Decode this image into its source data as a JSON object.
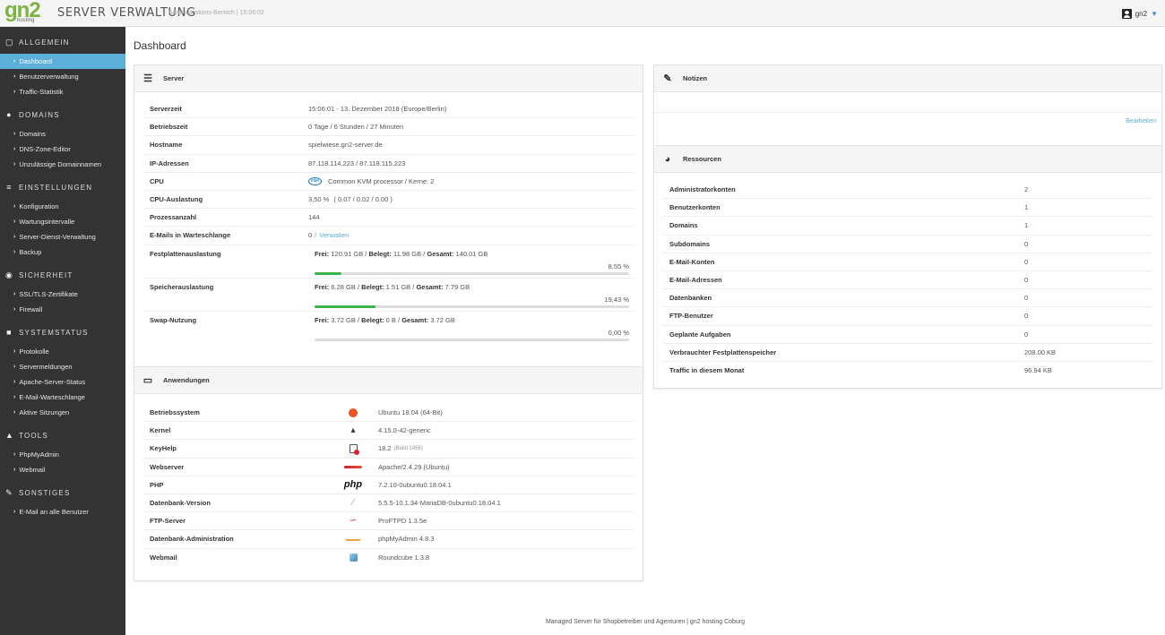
{
  "header": {
    "logo_text": "gn2",
    "logo_sub": "hosting",
    "title": "SERVER VERWALTUNG",
    "subtitle": "Administrations-Bereich | 15:06:02",
    "user": "gn2"
  },
  "sidebar": {
    "sections": [
      {
        "label": "ALLGEMEIN",
        "icon": "monitor-icon",
        "items": [
          "Dashboard",
          "Benutzerverwaltung",
          "Traffic-Statistik"
        ]
      },
      {
        "label": "DOMAINS",
        "icon": "globe-icon",
        "items": [
          "Domains",
          "DNS-Zone-Editor",
          "Unzulässige Domainnamen"
        ]
      },
      {
        "label": "EINSTELLUNGEN",
        "icon": "sliders-icon",
        "items": [
          "Konfiguration",
          "Wartungsintervalle",
          "Server-Dienst-Verwaltung",
          "Backup"
        ]
      },
      {
        "label": "SICHERHEIT",
        "icon": "shield-icon",
        "items": [
          "SSL/TLS-Zertifikate",
          "Firewall"
        ]
      },
      {
        "label": "SYSTEMSTATUS",
        "icon": "document-icon",
        "items": [
          "Protokolle",
          "Servermeldungen",
          "Apache-Server-Status",
          "E-Mail-Warteschlange",
          "Aktive Sitzungen"
        ]
      },
      {
        "label": "TOOLS",
        "icon": "car-icon",
        "items": [
          "PhpMyAdmin",
          "Webmail"
        ]
      },
      {
        "label": "SONSTIGES",
        "icon": "pen-icon",
        "items": [
          "E-Mail an alle Benutzer"
        ]
      }
    ],
    "active_item": "Dashboard"
  },
  "page_title": "Dashboard",
  "server": {
    "title": "Server",
    "rows": [
      {
        "key": "Serverzeit",
        "value": "15:06:01 - 13. Dezember 2018 (Europe/Berlin)"
      },
      {
        "key": "Betriebszeit",
        "value": "0 Tage / 6 Stunden / 27 Minuten"
      },
      {
        "key": "Hostname",
        "value": "spielwiese.gn2-server.de"
      },
      {
        "key": "IP-Adressen",
        "value": "87.118.114.223 / 87.118.115.223"
      },
      {
        "key": "CPU",
        "value": "Common KVM processor / Kerne: 2",
        "logo": "intel"
      },
      {
        "key": "CPU-Auslastung",
        "value_green": "3,50 %",
        "value": "( 0.07 / 0.02 / 0.00 )"
      },
      {
        "key": "Prozessanzahl",
        "value": "144"
      },
      {
        "key": "E-Mails in Warteschlange",
        "value": "0",
        "sep": "/",
        "link": "Verwalten"
      }
    ],
    "disks": [
      {
        "key": "Festplattenauslastung",
        "free_label": "Frei:",
        "free": "120.91 GB",
        "used_label": "Belegt:",
        "used": "11.98 GB",
        "total_label": "Gesamt:",
        "total": "140.01 GB",
        "pct": "8,55 %",
        "fraction": 0.0855
      },
      {
        "key": "Speicherauslastung",
        "free_label": "Frei:",
        "free": "6.28 GB",
        "used_label": "Belegt:",
        "used": "1.51 GB",
        "total_label": "Gesamt:",
        "total": "7.79 GB",
        "pct": "19,43 %",
        "fraction": 0.1943
      },
      {
        "key": "Swap-Nutzung",
        "free_label": "Frei:",
        "free": "3.72 GB",
        "used_label": "Belegt:",
        "used": "0 B",
        "total_label": "Gesamt:",
        "total": "3.72 GB",
        "pct": "0,00 %",
        "fraction": 0
      }
    ]
  },
  "apps": {
    "title": "Anwendungen",
    "rows": [
      {
        "key": "Betriebssystem",
        "value": "Ubuntu 18.04 (64-Bit)",
        "icon": "ubuntu-icon"
      },
      {
        "key": "Kernel",
        "value": "4.15.0-42-generic",
        "icon": "tux-icon"
      },
      {
        "key": "KeyHelp",
        "value": "18.2",
        "build": "(Build 1456)",
        "icon": "keyhelp-icon"
      },
      {
        "key": "Webserver",
        "value": "Apache/2.4.29 (Ubuntu)",
        "icon": "apache-icon"
      },
      {
        "key": "PHP",
        "value": "7.2.10-0ubuntu0.18.04.1",
        "icon": "php-icon",
        "icon_text": "php"
      },
      {
        "key": "Datenbank-Version",
        "value": "5.5.5-10.1.34-MariaDB-0ubuntu0.18.04.1",
        "icon": "mariadb-icon"
      },
      {
        "key": "FTP-Server",
        "value": "ProFTPD 1.3.5e",
        "icon": "proftpd-icon"
      },
      {
        "key": "Datenbank-Administration",
        "value": "phpMyAdmin 4.8.3",
        "icon": "phpmyadmin-icon"
      },
      {
        "key": "Webmail",
        "value": "Roundcube 1.3.8",
        "icon": "roundcube-icon"
      }
    ]
  },
  "notes": {
    "title": "Notizen",
    "edit": "Bearbeiten"
  },
  "resources": {
    "title": "Ressourcen",
    "rows": [
      {
        "key": "Administratorkonten",
        "value": "2"
      },
      {
        "key": "Benutzerkonten",
        "value": "1"
      },
      {
        "key": "Domains",
        "value": "1"
      },
      {
        "key": "Subdomains",
        "value": "0"
      },
      {
        "key": "E-Mail-Konten",
        "value": "0"
      },
      {
        "key": "E-Mail-Adressen",
        "value": "0"
      },
      {
        "key": "Datenbanken",
        "value": "0"
      },
      {
        "key": "FTP-Benutzer",
        "value": "0"
      },
      {
        "key": "Geplante Aufgaben",
        "value": "0"
      },
      {
        "key": "Verbrauchter Festplattenspeicher",
        "value": "208.00 KB"
      },
      {
        "key": "Traffic in diesem Monat",
        "value": "96.94 KB"
      }
    ]
  },
  "footer": "Managed Server für Shopbetreiber und Agenturen | gn2 hosting Coburg"
}
